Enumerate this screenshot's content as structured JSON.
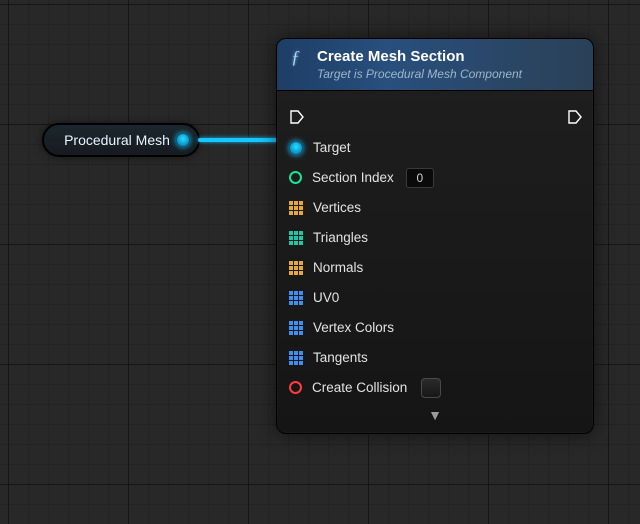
{
  "source_node": {
    "label": "Procedural Mesh"
  },
  "node": {
    "title": "Create Mesh Section",
    "subtitle": "Target is Procedural Mesh Component",
    "pins": {
      "target": {
        "label": "Target"
      },
      "section_index": {
        "label": "Section Index",
        "value": "0"
      },
      "vertices": {
        "label": "Vertices"
      },
      "triangles": {
        "label": "Triangles"
      },
      "normals": {
        "label": "Normals"
      },
      "uv0": {
        "label": "UV0"
      },
      "vertex_colors": {
        "label": "Vertex Colors"
      },
      "tangents": {
        "label": "Tangents"
      },
      "create_collision": {
        "label": "Create Collision",
        "checked": false
      }
    }
  }
}
